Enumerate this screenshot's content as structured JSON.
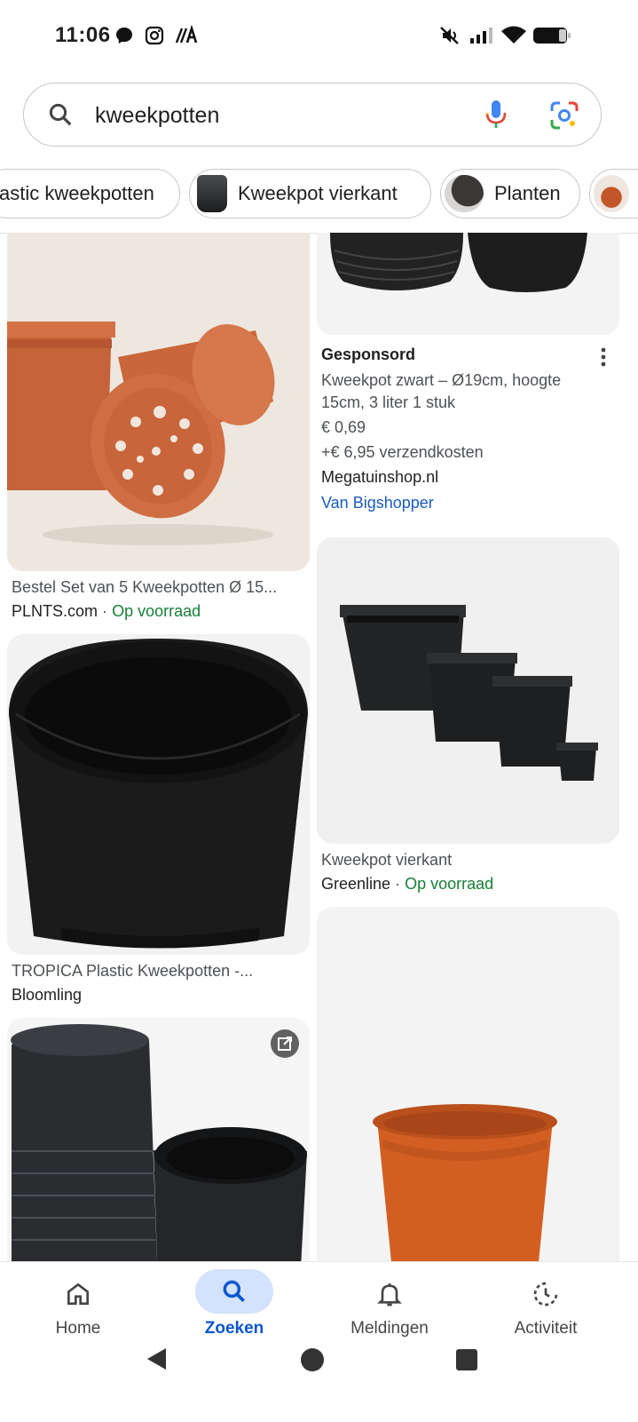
{
  "status_bar": {
    "time": "11:06"
  },
  "search": {
    "query": "kweekpotten"
  },
  "chips": [
    {
      "label": "astic kweekpotten"
    },
    {
      "label": "Kweekpot vierkant"
    },
    {
      "label": "Planten"
    }
  ],
  "results": {
    "left": [
      {
        "title": "Bestel Set van 5 Kweekpotten Ø 15...",
        "source": "PLNTS.com",
        "stock": "Op voorraad"
      },
      {
        "title": "TROPICA Plastic Kweekpotten -...",
        "source": "Bloomling"
      }
    ],
    "right": [
      {
        "sponsored": "Gesponsord",
        "title_line1": "Kweekpot zwart – Ø19cm, hoogte",
        "title_line2": "15cm, 3 liter 1 stuk",
        "price": "€ 0,69",
        "shipping": "+€ 6,95 verzendkosten",
        "source": "Megatuinshop.nl",
        "via": "Van Bigshopper"
      },
      {
        "title": "Kweekpot vierkant",
        "source": "Greenline",
        "stock": "Op voorraad"
      }
    ],
    "separator": "·"
  },
  "bottom_nav": [
    {
      "label": "Home"
    },
    {
      "label": "Zoeken"
    },
    {
      "label": "Meldingen"
    },
    {
      "label": "Activiteit"
    }
  ]
}
